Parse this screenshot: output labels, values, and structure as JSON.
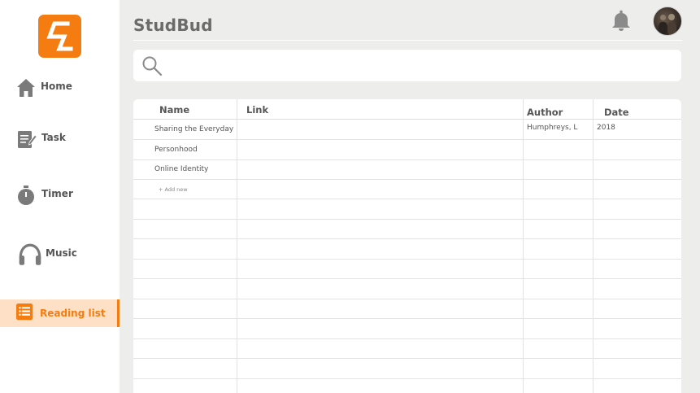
{
  "app": {
    "title": "StudBud"
  },
  "sidebar": {
    "logo_letter": "S",
    "items": [
      {
        "label": "Home",
        "icon": "home-icon"
      },
      {
        "label": "Task",
        "icon": "task-icon"
      },
      {
        "label": "Timer",
        "icon": "stopwatch-icon"
      },
      {
        "label": "Music",
        "icon": "headphones-icon"
      },
      {
        "label": "Reading list",
        "icon": "list-icon",
        "active": true
      }
    ]
  },
  "header": {
    "notification_icon": "bell-icon",
    "avatar": "user-avatar"
  },
  "search": {
    "placeholder": "",
    "value": ""
  },
  "table": {
    "columns": [
      "Name",
      "Link",
      "Author",
      "Date"
    ],
    "rows": [
      {
        "name": "Sharing the Everyday",
        "link": "",
        "author": "Humphreys, L",
        "date": "2018"
      },
      {
        "name": "Personhood",
        "link": "",
        "author": "",
        "date": ""
      },
      {
        "name": "Online Identity",
        "link": "",
        "author": "",
        "date": ""
      }
    ],
    "add_new_label": "+ Add new"
  },
  "colors": {
    "accent": "#f57c10",
    "active_bg": "#fde0c6",
    "main_bg": "#ededeb"
  }
}
